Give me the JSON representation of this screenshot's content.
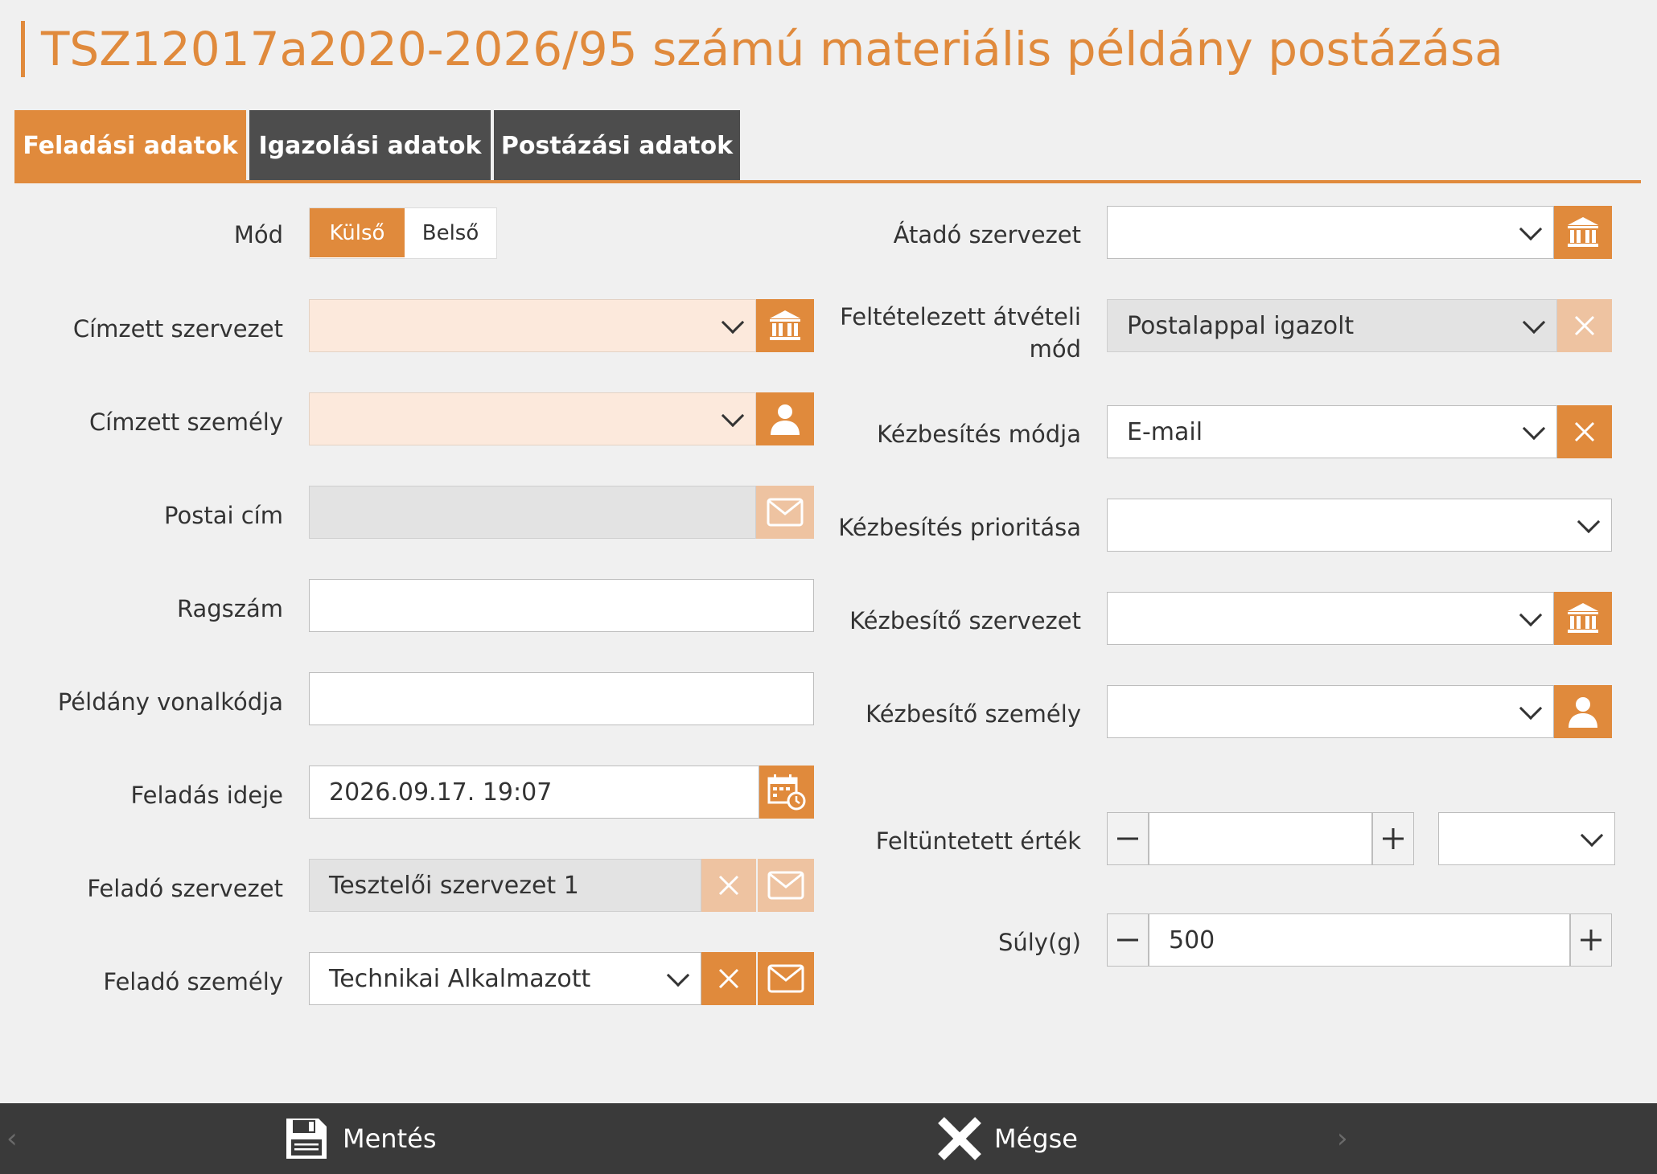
{
  "page": {
    "title": "TSZ12017a2020-2026/95 számú materiális példány postázása"
  },
  "tabs": [
    {
      "label": "Feladási adatok",
      "active": true
    },
    {
      "label": "Igazolási adatok",
      "active": false
    },
    {
      "label": "Postázási adatok",
      "active": false
    }
  ],
  "left": {
    "mode": {
      "label": "Mód",
      "options": [
        "Külső",
        "Belső"
      ],
      "selected": "Külső"
    },
    "recipient_org": {
      "label": "Címzett szervezet",
      "value": ""
    },
    "recipient_person": {
      "label": "Címzett személy",
      "value": ""
    },
    "postal_address": {
      "label": "Postai cím",
      "value": ""
    },
    "tracking_number": {
      "label": "Ragszám",
      "value": ""
    },
    "barcode": {
      "label": "Példány vonalkódja",
      "value": ""
    },
    "send_time": {
      "label": "Feladás ideje",
      "value": "2026.09.17. 19:07"
    },
    "sender_org": {
      "label": "Feladó szervezet",
      "value": "Tesztelői szervezet 1"
    },
    "sender_person": {
      "label": "Feladó személy",
      "value": "Technikai Alkalmazott"
    }
  },
  "right": {
    "handover_org": {
      "label": "Átadó szervezet",
      "value": ""
    },
    "receipt_mode": {
      "label_line1": "Feltételezett átvételi",
      "label_line2": "mód",
      "value": "Postalappal igazolt"
    },
    "delivery_mode": {
      "label": "Kézbesítés módja",
      "value": "E-mail"
    },
    "delivery_priority": {
      "label": "Kézbesítés prioritása",
      "value": ""
    },
    "courier_org": {
      "label": "Kézbesítő szervezet",
      "value": ""
    },
    "courier_person": {
      "label": "Kézbesítő személy",
      "value": ""
    },
    "declared_value": {
      "label": "Feltüntetett érték",
      "value": "",
      "currency": ""
    },
    "weight": {
      "label": "Súly(g)",
      "value": "500"
    }
  },
  "footer": {
    "save_label": "Mentés",
    "cancel_label": "Mégse"
  },
  "colors": {
    "accent": "#e08a3c",
    "accent_light": "#eec3a1",
    "tab_dark": "#4d4d4d",
    "bar": "#3a3a3a"
  }
}
